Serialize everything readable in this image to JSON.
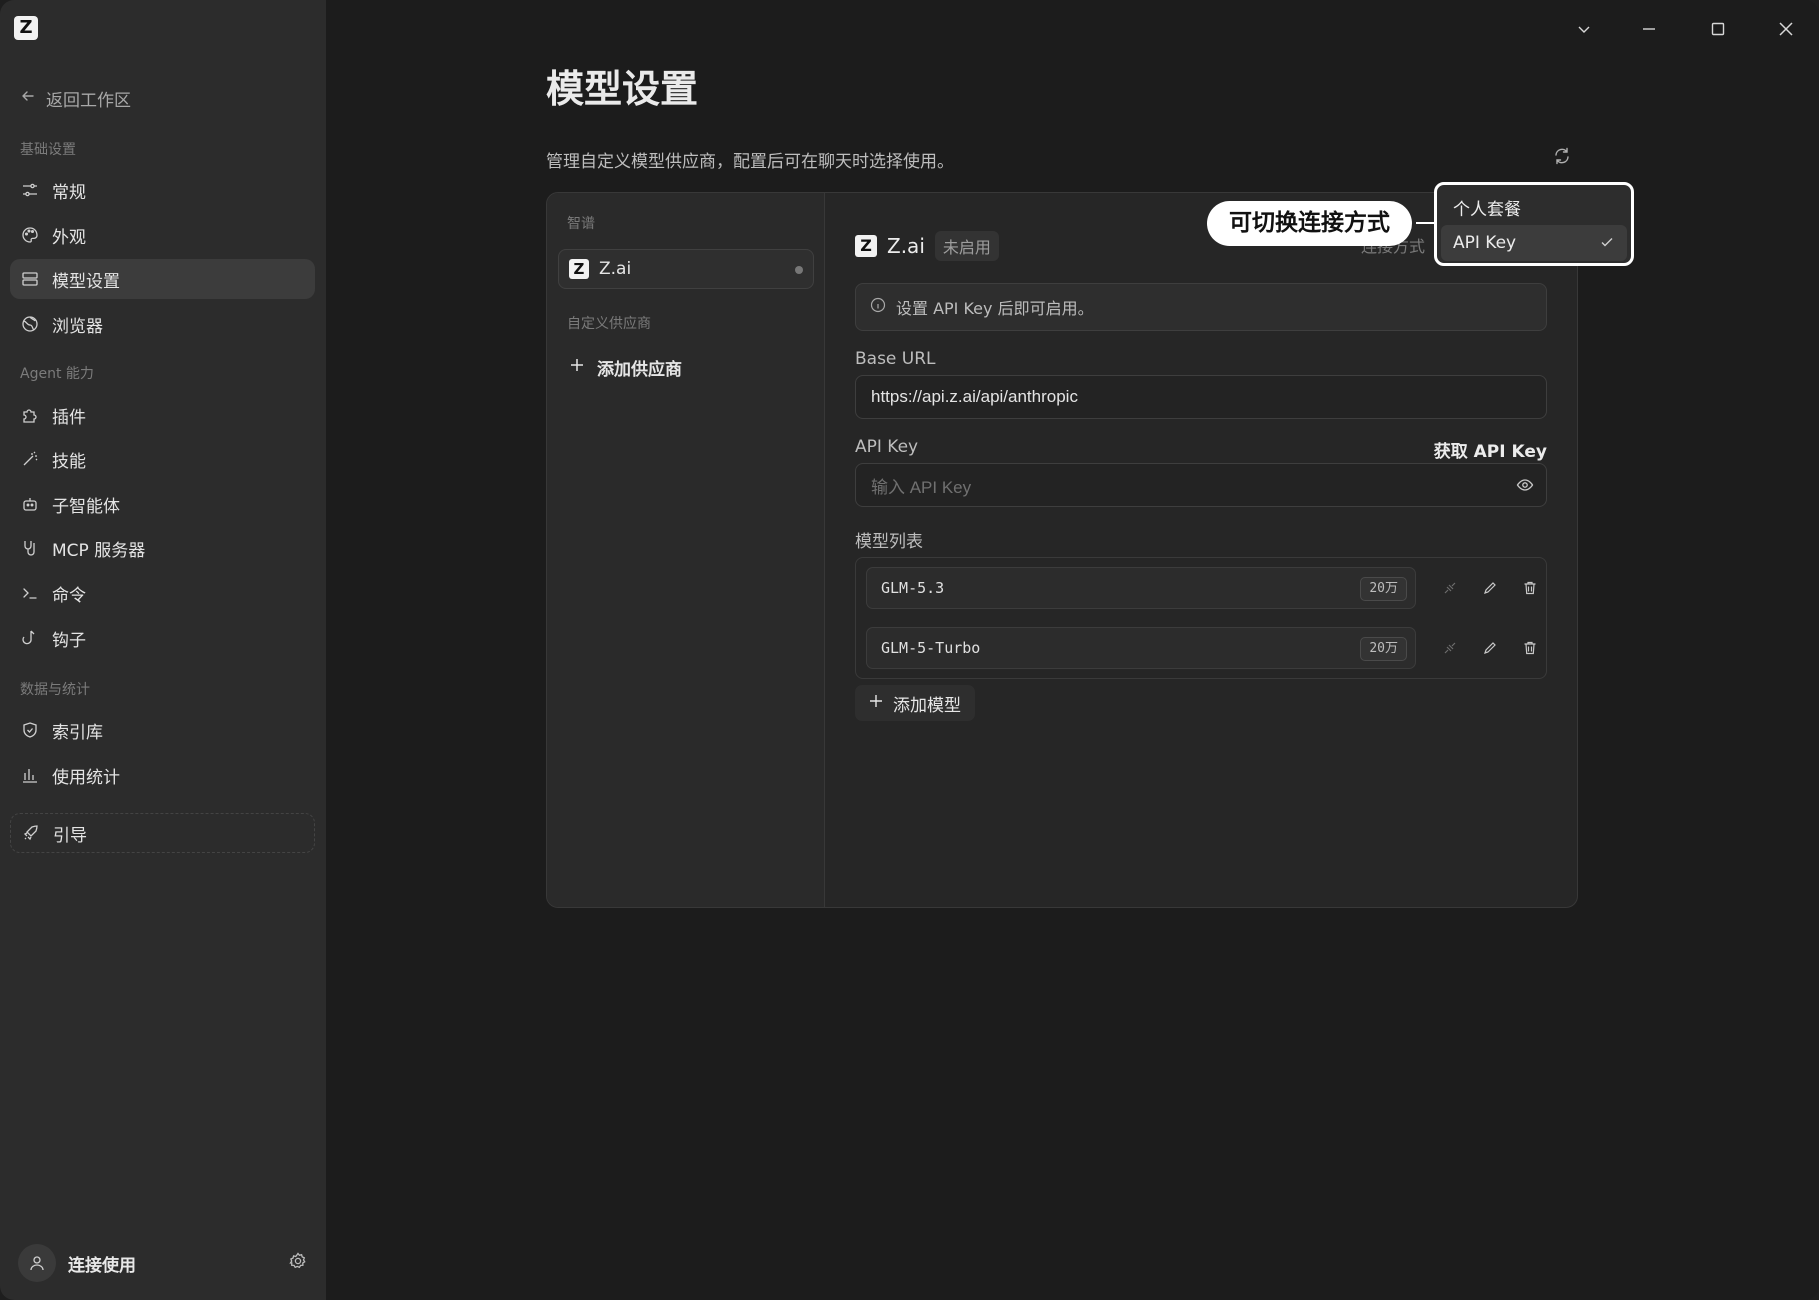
{
  "sidebar": {
    "back_label": "返回工作区",
    "sections": {
      "basic": "基础设置",
      "agent": "Agent 能力",
      "data": "数据与统计"
    },
    "items": [
      {
        "label": "常规",
        "icon": "sliders-icon"
      },
      {
        "label": "外观",
        "icon": "palette-icon"
      },
      {
        "label": "模型设置",
        "icon": "server-icon",
        "active": true
      },
      {
        "label": "浏览器",
        "icon": "globe-icon"
      },
      {
        "label": "插件",
        "icon": "puzzle-icon"
      },
      {
        "label": "技能",
        "icon": "wand-icon"
      },
      {
        "label": "子智能体",
        "icon": "bot-icon"
      },
      {
        "label": "MCP 服务器",
        "icon": "plug-icon"
      },
      {
        "label": "命令",
        "icon": "terminal-icon"
      },
      {
        "label": "钩子",
        "icon": "hook-icon"
      },
      {
        "label": "索引库",
        "icon": "shield-icon"
      },
      {
        "label": "使用统计",
        "icon": "bar-chart-icon"
      },
      {
        "label": "引导",
        "icon": "rocket-icon"
      }
    ],
    "footer_label": "连接使用"
  },
  "page": {
    "title": "模型设置",
    "description": "管理自定义模型供应商，配置后可在聊天时选择使用。"
  },
  "providers": {
    "section_zhipu": "智谱",
    "selected_provider": "Z.ai",
    "section_custom": "自定义供应商",
    "add_label": "添加供应商"
  },
  "detail": {
    "provider_name": "Z.ai",
    "status": "未启用",
    "connection_label": "连接方式",
    "notice": "设置 API Key 后即可启用。",
    "base_url_label": "Base URL",
    "base_url_value": "https://api.z.ai/api/anthropic",
    "api_key_label": "API Key",
    "get_api_key": "获取 API Key",
    "api_key_placeholder": "输入 API Key",
    "models_label": "模型列表",
    "models": [
      {
        "name": "GLM-5.3",
        "context": "20万"
      },
      {
        "name": "GLM-5-Turbo",
        "context": "20万"
      }
    ],
    "add_model": "添加模型"
  },
  "overlay": {
    "callout": "可切换连接方式",
    "options": [
      {
        "label": "个人套餐",
        "selected": false
      },
      {
        "label": "API Key",
        "selected": true
      }
    ]
  }
}
